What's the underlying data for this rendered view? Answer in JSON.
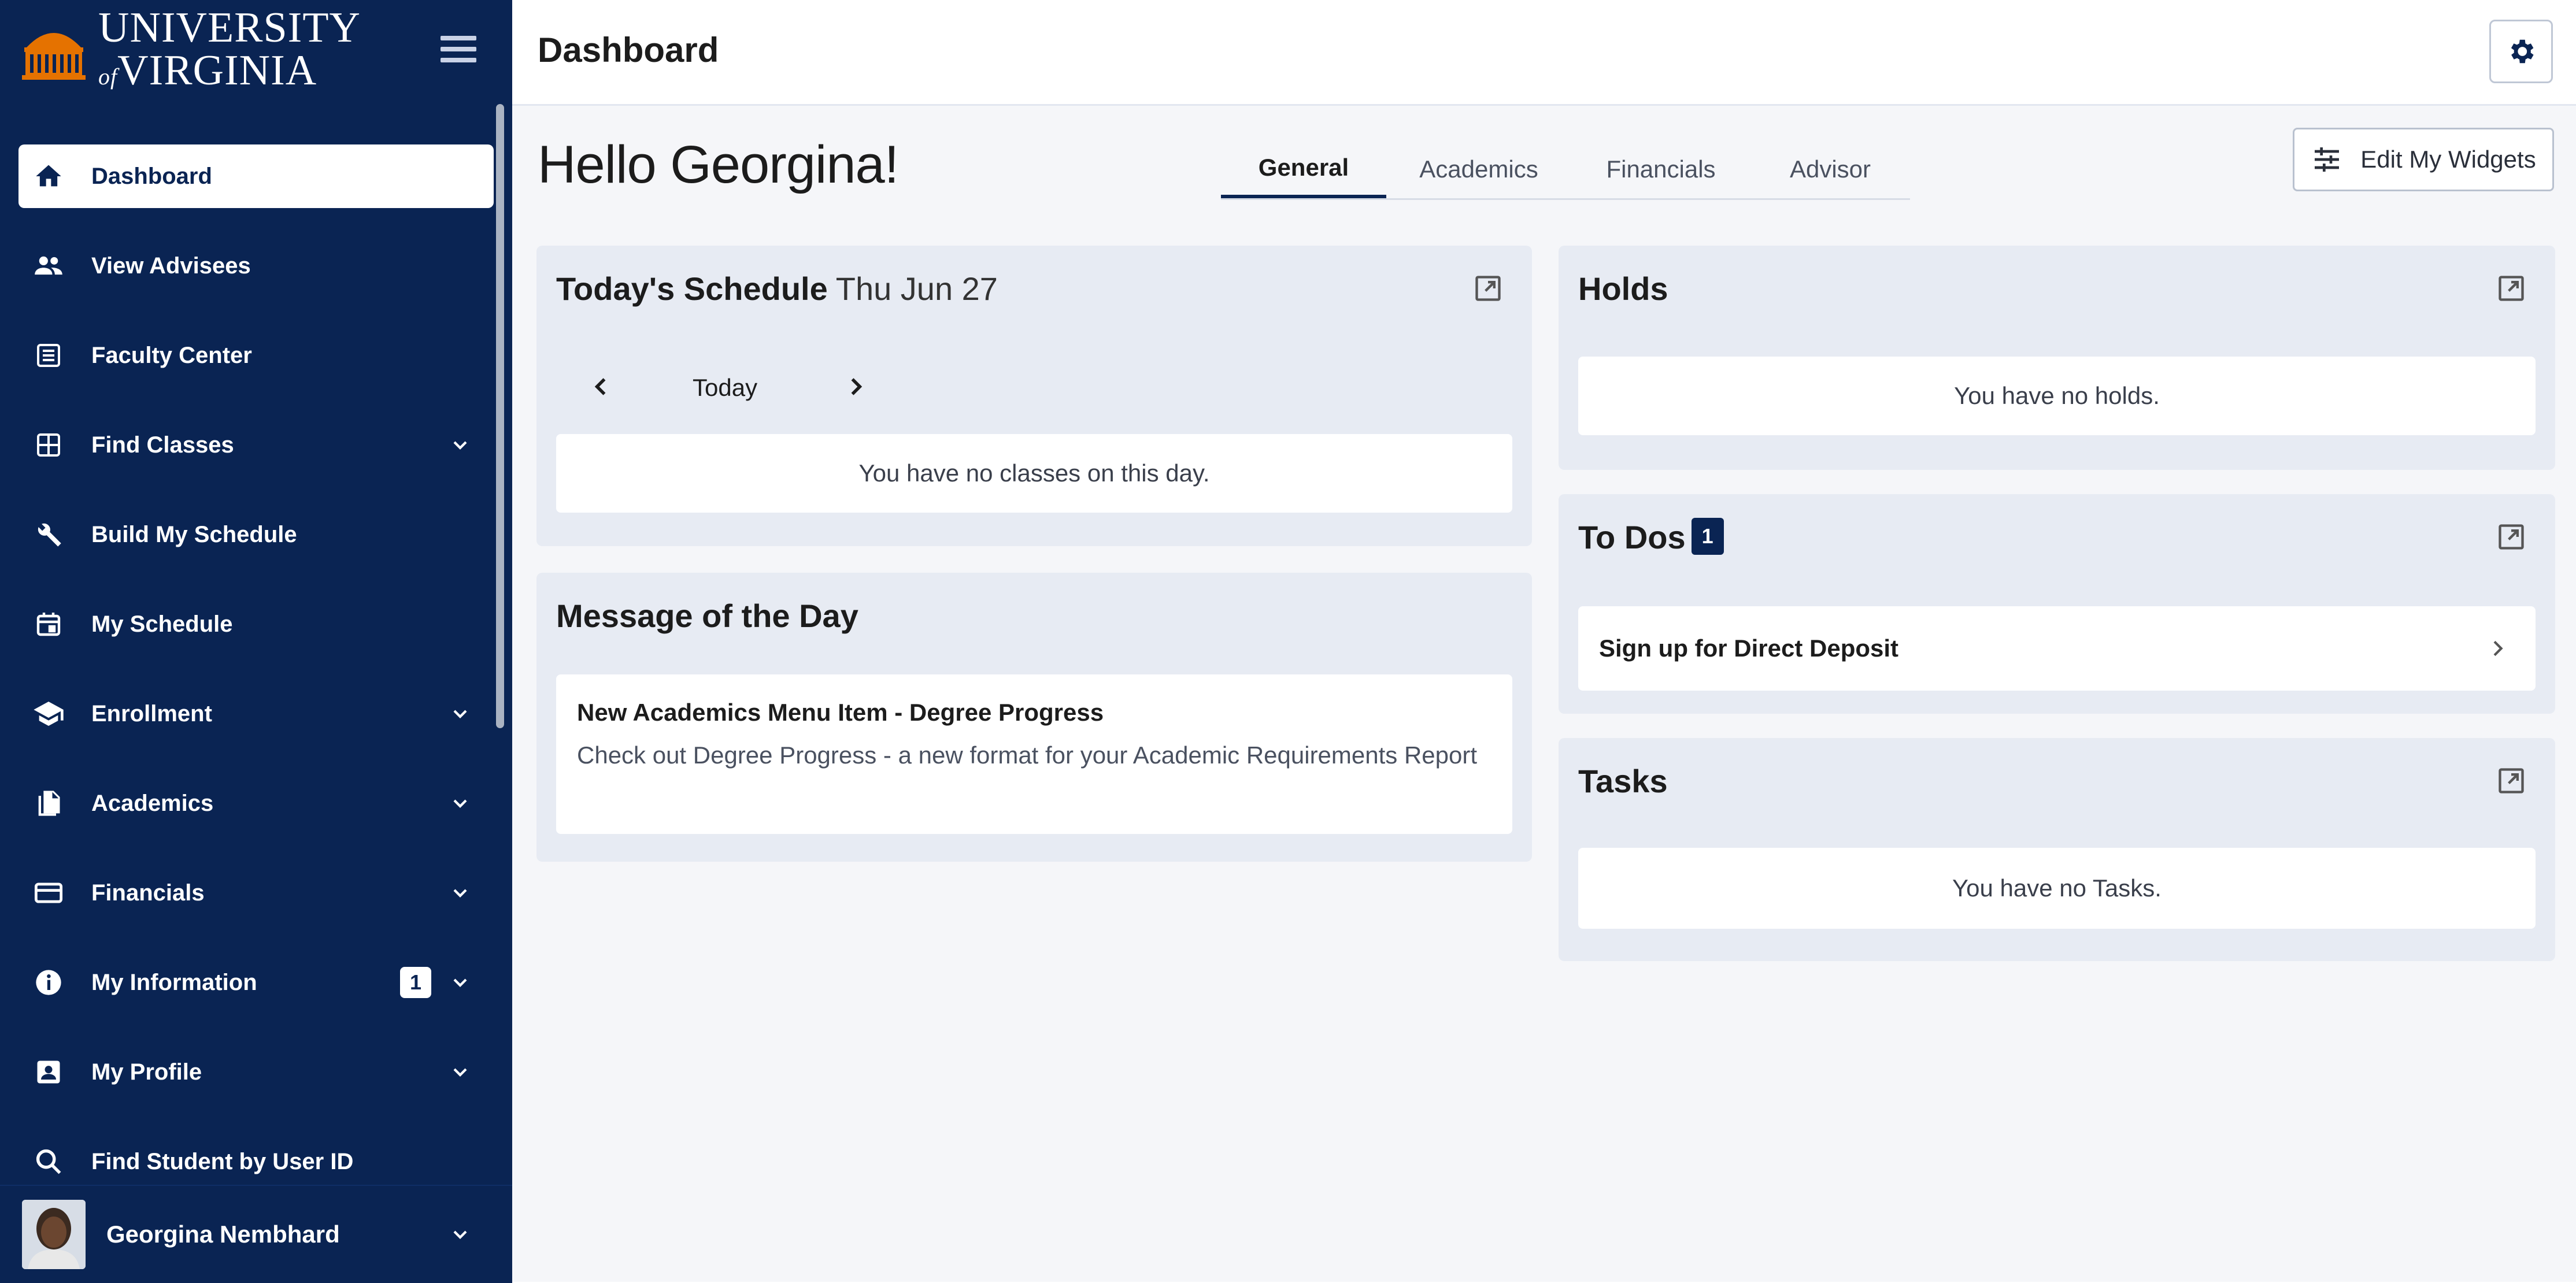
{
  "brand": {
    "line1": "UNIVERSITY",
    "line2": "VIRGINIA",
    "of": "of"
  },
  "header": {
    "title": "Dashboard"
  },
  "sidebar": {
    "items": [
      {
        "label": "Dashboard",
        "icon": "home-icon"
      },
      {
        "label": "View Advisees",
        "icon": "people-icon"
      },
      {
        "label": "Faculty Center",
        "icon": "list-icon"
      },
      {
        "label": "Find Classes",
        "icon": "grid-icon"
      },
      {
        "label": "Build My Schedule",
        "icon": "wrench-icon"
      },
      {
        "label": "My Schedule",
        "icon": "calendar-icon"
      },
      {
        "label": "Enrollment",
        "icon": "graduation-icon"
      },
      {
        "label": "Academics",
        "icon": "documents-icon"
      },
      {
        "label": "Financials",
        "icon": "card-icon"
      },
      {
        "label": "My Information",
        "icon": "info-icon",
        "badge": "1"
      },
      {
        "label": "My Profile",
        "icon": "profile-icon"
      },
      {
        "label": "Find Student by User ID",
        "icon": "search-icon"
      }
    ],
    "user": {
      "name": "Georgina Nembhard"
    }
  },
  "main": {
    "greeting": "Hello Georgina!",
    "tabs": [
      {
        "label": "General",
        "active": true
      },
      {
        "label": "Academics"
      },
      {
        "label": "Financials"
      },
      {
        "label": "Advisor"
      }
    ],
    "edit_button": "Edit My Widgets",
    "schedule": {
      "title": "Today's Schedule",
      "date": "Thu Jun 27",
      "nav_label": "Today",
      "empty": "You have no classes on this day."
    },
    "message": {
      "title": "Message of the Day",
      "headline": "New Academics Menu Item - Degree Progress",
      "body": "Check out Degree Progress - a new format for your Academic Requirements Report"
    },
    "holds": {
      "title": "Holds",
      "empty": "You have no holds."
    },
    "todos": {
      "title": "To Dos",
      "count": "1",
      "item": "Sign up for Direct Deposit"
    },
    "tasks": {
      "title": "Tasks",
      "empty": "You have no Tasks."
    }
  },
  "colors": {
    "navy": "#0a2453",
    "accent_orange": "#e57200"
  }
}
